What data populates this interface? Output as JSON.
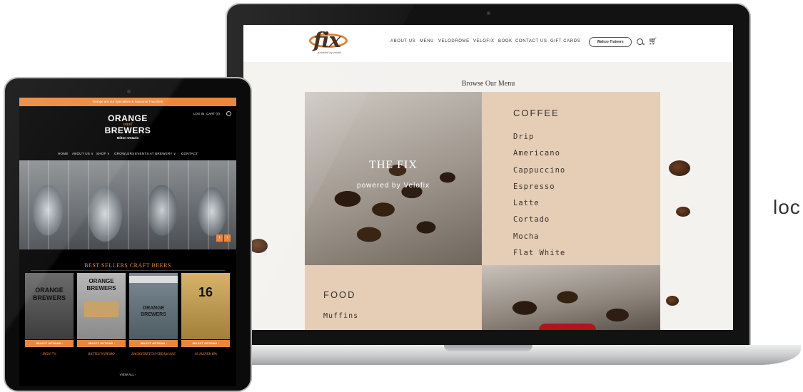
{
  "laptop": {
    "site": {
      "logo": {
        "word": "fix",
        "sub": "powered by velofix"
      },
      "nav": [
        "ABOUT US",
        "MENU",
        "VELODROME",
        "VELOFIX",
        "BOOK",
        "CONTACT US",
        "GIFT CARDS"
      ],
      "cta": "Wahoo Trainers",
      "icons": {
        "search": "search-icon",
        "cart": "cart-icon"
      }
    },
    "menu": {
      "heading": "Browse Our Menu",
      "hero_title": "THE FIX",
      "hero_subtitle": "powered by Velofix",
      "coffee": {
        "title": "COFFEE",
        "items": [
          "Drip",
          "Americano",
          "Cappuccino",
          "Espresso",
          "Latte",
          "Cortado",
          "Mocha",
          "Flat White"
        ]
      },
      "food": {
        "title": "FOOD",
        "items": [
          "Muffins"
        ]
      }
    }
  },
  "side_text": "loc",
  "tablet": {
    "banner": "Orange are our Specialties & Seasonal Favorites!",
    "header": {
      "login": "LOG IN",
      "cart": "CART (0)"
    },
    "logo": {
      "line1": "ORANGE",
      "line2": "small",
      "line3": "BREWERS",
      "line4": "Milton Ontario"
    },
    "nav": [
      "HOME",
      "ABOUT US ∨",
      "SHOP ∨",
      "GROWLERS",
      "EVENTS AT BREWERY ∨",
      "CONTACT"
    ],
    "best_sellers_title": "BEST SELLERS CRAFT BEERS",
    "products": [
      {
        "label": "IRON 7%",
        "button": "SELECT OPTIONS ›"
      },
      {
        "label": "RATTLE'N'HEMO",
        "button": "SELECT OPTIONS ›"
      },
      {
        "label": "BACKSTRETCH CREAM ALE",
        "button": "SELECT OPTIONS ›"
      },
      {
        "label": "16 JASPER IPA",
        "button": "SELECT OPTIONS ›"
      }
    ],
    "view_all": "VIEW ALL ›"
  },
  "colors": {
    "orange": "#e9873c",
    "tan": "#e6cdb5",
    "coffee_dark": "#3d2415"
  }
}
